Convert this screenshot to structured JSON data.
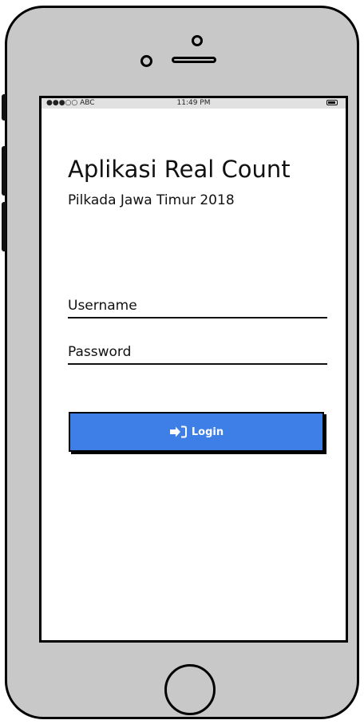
{
  "status_bar": {
    "carrier": "●●●○○ ABC",
    "time": "11:49 PM"
  },
  "app": {
    "title": "Aplikasi Real Count",
    "subtitle": "Pilkada Jawa Timur 2018"
  },
  "form": {
    "username_label": "Username",
    "password_label": "Password",
    "login_label": "Login"
  },
  "colors": {
    "button": "#3d7fe6",
    "phone_body": "#c8c8c8"
  }
}
